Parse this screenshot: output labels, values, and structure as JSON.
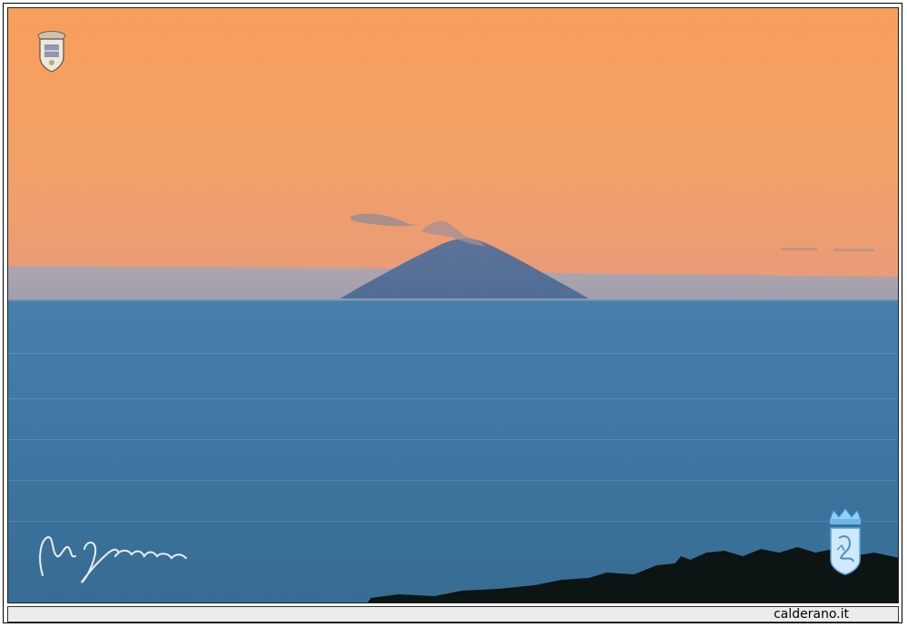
{
  "footer": {
    "site_label": "calderano.it"
  },
  "colors": {
    "sky_top": "#f6a05e",
    "sky_horizon": "#e99a7a",
    "haze": "#9aa3b8",
    "sea_top": "#3f7aa6",
    "sea_bottom": "#3a6f95",
    "volcano": "#566f97",
    "shore_silhouette": "#0c1414",
    "crest_blue": "#6fb4e8",
    "signature_white": "#e8eef6"
  },
  "icons": {
    "top_left": "crest-emblem-icon",
    "bottom_right": "crest-emblem-icon",
    "signature": "signature-mark"
  }
}
